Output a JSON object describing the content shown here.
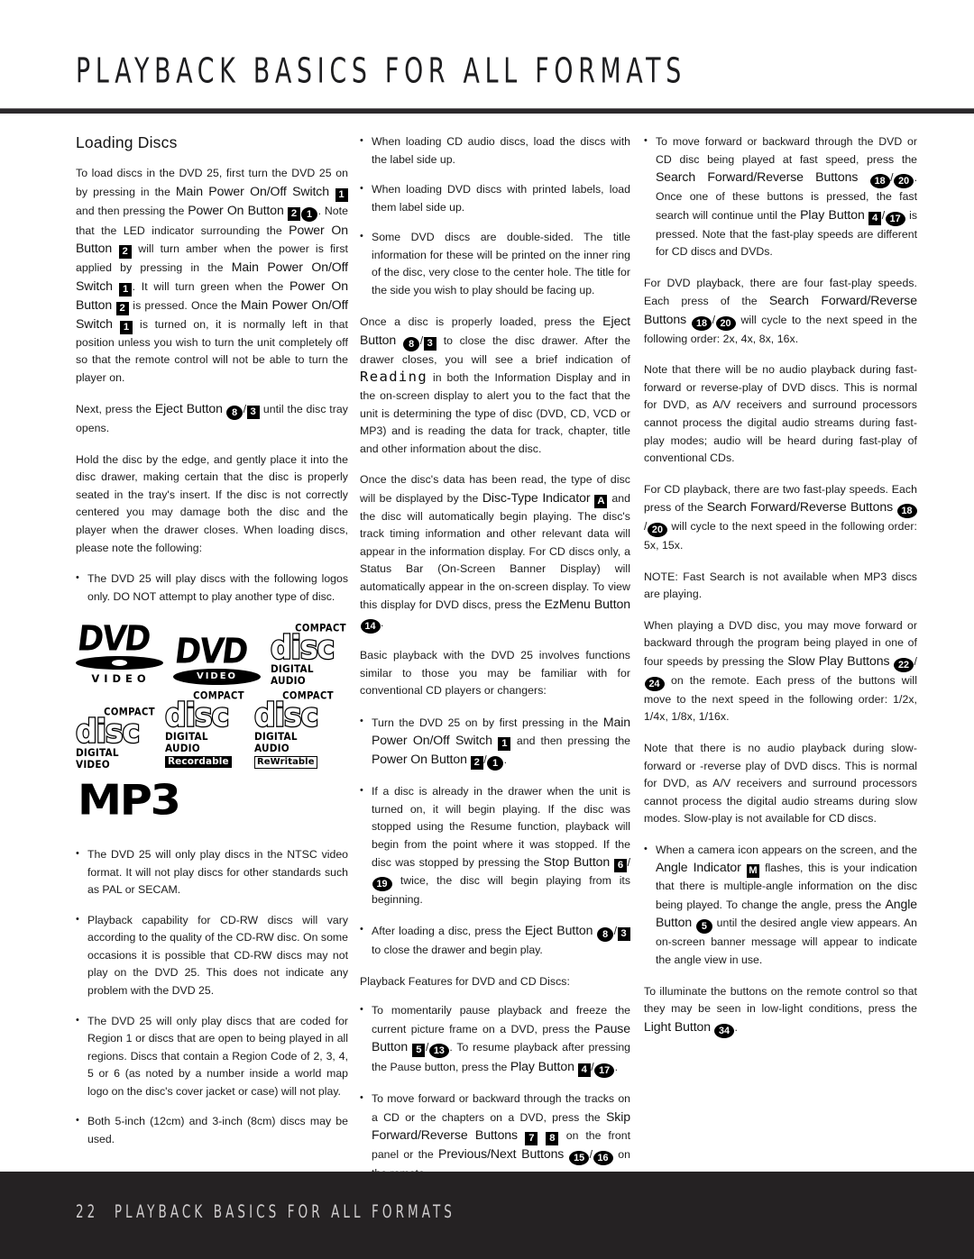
{
  "header": {
    "title": "PLAYBACK BASICS FOR ALL FORMATS"
  },
  "footer": {
    "page_number": "22",
    "title": "PLAYBACK BASICS FOR ALL FORMATS"
  },
  "badges": {
    "b1": "1",
    "b2": "2",
    "b3": "3",
    "b4": "4",
    "b5": "5",
    "b6": "6",
    "b7": "7",
    "b8": "8",
    "bA": "A",
    "bM": "M",
    "c1": "1",
    "c5": "5",
    "c8": "8",
    "c13": "13",
    "c14": "14",
    "c15": "15",
    "c16": "16",
    "c17": "17",
    "c19": "19",
    "c18": "18",
    "c20": "20",
    "c22": "22",
    "c24": "24",
    "c34": "34",
    "slash": "/"
  },
  "column1": {
    "section_title": "Loading Discs",
    "p1_a": "To load discs in the DVD 25, first turn the DVD 25 on by pressing in the ",
    "p1_ctl1": "Main Power On/Off Switch",
    "p1_b": " and then pressing the ",
    "p1_ctl2": "Power On Button",
    "p1_c": ". Note that the LED indicator surrounding the ",
    "p1_ctl3": "Power On Button",
    "p1_d": " will turn amber when the power is first applied by pressing in the ",
    "p1_ctl4": "Main Power On/Off Switch",
    "p1_e": ". It will turn green when the ",
    "p1_ctl5": "Power On Button",
    "p1_f": " is pressed. Once the ",
    "p1_ctl6": "Main Power On/Off Switch",
    "p1_g": " is turned on, it is normally left in that position unless you wish to turn the unit completely off so that the remote control will not be able to turn the player on.",
    "p2_a": "Next, press the ",
    "p2_ctl": "Eject Button",
    "p2_b": " until the disc tray opens.",
    "p3": "Hold the disc by the edge, and gently place it into the disc drawer, making certain that the disc is properly seated in the tray's insert. If the disc is not correctly centered you may damage both the disc and the player when the drawer closes. When loading discs, please note the following:",
    "bullet1": "The DVD 25 will play discs with the following logos only. DO NOT attempt to play another type of disc.",
    "bullet2": "The DVD 25 will only play discs in the NTSC video format. It will not play discs for other standards such as PAL or SECAM.",
    "bullet3": "Playback capability for CD-RW discs will vary according to the quality of the CD-RW disc. On some occasions it is possible that CD-RW discs may not play on the DVD 25. This does not indicate any problem with the DVD 25.",
    "bullet4": "The DVD 25 will only play discs that are coded for Region 1 or discs that are open to being played in all regions. Discs that contain a Region Code of 2, 3, 4, 5 or 6 (as noted by a number inside a world map logo on the disc's cover jacket or case) will not play.",
    "bullet5": "Both 5-inch (12cm) and 3-inch (8cm) discs may be used."
  },
  "logos": [
    {
      "name": "dvd-video-logo",
      "word": "DVD",
      "sub": "VIDEO"
    },
    {
      "name": "dvd-video-oval-logo",
      "word": "DVD",
      "sub": "VIDEO"
    },
    {
      "name": "compact-disc-digital-audio-logo",
      "compact": "COMPACT",
      "disc": "disc",
      "caption": "DIGITAL AUDIO"
    },
    {
      "name": "compact-disc-digital-video-logo",
      "compact": "COMPACT",
      "disc": "disc",
      "caption": "DIGITAL VIDEO"
    },
    {
      "name": "compact-disc-recordable-logo",
      "compact": "COMPACT",
      "disc": "disc",
      "caption": "DIGITAL AUDIO",
      "tag": "Recordable"
    },
    {
      "name": "compact-disc-rewritable-logo",
      "compact": "COMPACT",
      "disc": "disc",
      "caption": "DIGITAL AUDIO",
      "tag": "ReWritable"
    },
    {
      "name": "mp3-logo",
      "word": "MP3"
    }
  ],
  "column2": {
    "bullet1": "When loading CD audio discs, load the discs with the label side up.",
    "bullet2": "When loading DVD discs with printed labels, load them label side up.",
    "bullet3": "Some DVD discs are double-sided. The title information for these will be printed on the inner ring of the disc, very close to the center hole. The title for the side you wish to play should be facing up.",
    "p1_a": "Once a disc is properly loaded, press the ",
    "p1_ctl": "Eject Button",
    "p1_b": " to close the disc drawer. After the drawer closes, you will see a brief indication of ",
    "p1_screenword": "Reading",
    "p1_c": " in both the Information Display and in the on-screen display to alert you to the fact that the unit is determining the type of disc (DVD, CD, VCD or MP3) and is reading the data for track, chapter, title and other information about the disc.",
    "p2_a": "Once the disc's data has been read, the type of disc will be displayed by the ",
    "p2_ctl": "Disc-Type Indicator",
    "p2_b": " and the disc will automatically begin playing. The disc's track timing information and other relevant data will appear in the information display. For CD discs only, a Status Bar (On-Screen Banner Display) will automatically appear in the on-screen display. To view this display for DVD discs, press the ",
    "p2_ctl2": "EzMenu Button",
    "p2_c": ".",
    "p3": "Basic playback with the DVD 25 involves functions similar to those you may be familiar with for conventional CD players or changers:",
    "b4_a": "Turn the DVD 25 on by first pressing in the ",
    "b4_ctl1": "Main Power On/Off Switch",
    "b4_b": " and then pressing the ",
    "b4_ctl2": "Power On Button",
    "b4_c": ".",
    "b5_a": "If a disc is already in the drawer when the unit is turned on, it will begin playing. If the disc was stopped using the Resume function, playback will begin from the point where it was stopped. If the disc was stopped by pressing the ",
    "b5_ctl": "Stop Button",
    "b5_b": " twice, the disc will begin playing from its beginning.",
    "b6_a": "After loading a disc, press the ",
    "b6_ctl": "Eject Button",
    "b6_b": " to close the drawer and begin play.",
    "p4": "Playback Features for DVD and CD Discs:",
    "b7_a": "To momentarily pause playback and freeze the current picture frame on a DVD, press the ",
    "b7_ctl1": "Pause Button",
    "b7_b": ". To resume playback after pressing the Pause button, press the ",
    "b7_ctl2": "Play Button",
    "b7_c": ".",
    "b8_a": "To move forward or backward through the tracks on a CD or the chapters on a DVD, press the ",
    "b8_ctl1": "Skip Forward/Reverse Buttons",
    "b8_b": " on the front panel or the ",
    "b8_ctl2": "Previous/Next Buttons",
    "b8_c": " on the remote."
  },
  "column3": {
    "b1_a": "To move forward or backward through the DVD or CD disc being played at fast speed, press the ",
    "b1_ctl1": "Search Forward/Reverse Buttons",
    "b1_b": ". Once one of these buttons is pressed, the fast search will continue until the ",
    "b1_ctl2": "Play Button",
    "b1_c": " is pressed. Note that the fast-play speeds are different for CD discs and DVDs.",
    "p1_a": "For DVD playback, there are four fast-play speeds. Each press of the ",
    "p1_ctl": "Search Forward/Reverse Buttons",
    "p1_b": " will cycle to the next speed in the following order: 2x, 4x, 8x, 16x.",
    "p2": "Note that there will be no audio playback during fast-forward or reverse-play of DVD discs. This is normal for DVD, as A/V receivers and surround processors cannot process the digital audio streams during fast-play modes; audio will be heard during fast-play of conventional CDs.",
    "p3_a": "For CD playback, there are two fast-play speeds. Each press of the ",
    "p3_ctl": "Search Forward/Reverse Buttons",
    "p3_b": " will cycle to the next speed in the following order: 5x, 15x.",
    "p4": "NOTE: Fast Search is not available when MP3 discs are playing.",
    "p5_a": "When playing a DVD disc, you may move forward or backward through the program being played in one of four speeds by pressing the ",
    "p5_ctl": "Slow Play Buttons",
    "p5_b": " on the remote. Each press of the buttons will move to the next speed in the following order: 1/2x, 1/4x, 1/8x, 1/16x.",
    "p6": "Note that there is no audio playback during slow-forward or -reverse play of DVD discs. This is normal for DVD, as A/V receivers and surround processors cannot process the digital audio streams during slow modes. Slow-play is not available for CD discs.",
    "b2_a": "When a camera icon appears on the screen, and the ",
    "b2_ctl1": "Angle Indicator",
    "b2_b": " flashes, this is your indication that there is multiple-angle information on the disc being played. To change the angle, press the ",
    "b2_ctl2": "Angle Button",
    "b2_c": " until the desired angle view appears. An on-screen banner message will appear to indicate the angle view in use.",
    "p7_a": "To illuminate the buttons on the remote control so that they may be seen in low-light conditions, press the ",
    "p7_ctl": "Light Button",
    "p7_b": "."
  }
}
